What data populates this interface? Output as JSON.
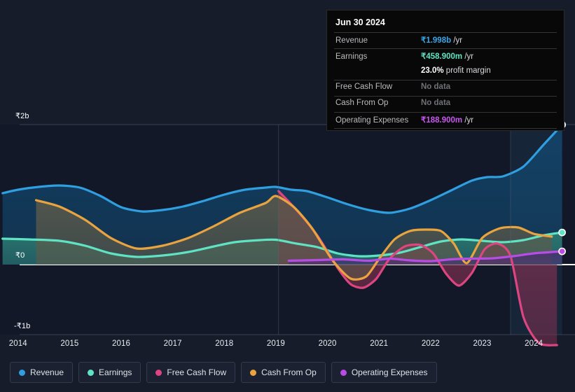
{
  "chart_data": {
    "type": "area",
    "title": "",
    "xlabel": "",
    "ylabel": "",
    "currency_symbol": "₹",
    "x_ticks": [
      "2014",
      "2015",
      "2016",
      "2017",
      "2018",
      "2019",
      "2020",
      "2021",
      "2022",
      "2023",
      "2024"
    ],
    "y_ticks": [
      {
        "label": "₹2b",
        "value": 2.0
      },
      {
        "label": "₹0",
        "value": 0.0
      },
      {
        "label": "-₹1b",
        "value": -1.0
      }
    ],
    "ylim": [
      -1.35,
      2.15
    ],
    "xlim": [
      2013.65,
      2024.8
    ],
    "grid": true,
    "legend_position": "bottom",
    "units": "billions of INR",
    "series": [
      {
        "name": "Revenue",
        "color": "#2f9fe0",
        "fill": "#12476e",
        "end_marker": true,
        "x": [
          2013.7,
          2014.0,
          2014.4,
          2014.8,
          2015.2,
          2015.6,
          2016.0,
          2016.4,
          2016.8,
          2017.2,
          2017.6,
          2018.0,
          2018.4,
          2018.8,
          2019.0,
          2019.3,
          2019.6,
          2020.0,
          2020.4,
          2020.8,
          2021.2,
          2021.6,
          2022.0,
          2022.4,
          2022.8,
          2023.1,
          2023.4,
          2023.8,
          2024.2,
          2024.55
        ],
        "y": [
          1.02,
          1.07,
          1.11,
          1.13,
          1.1,
          0.98,
          0.82,
          0.76,
          0.78,
          0.83,
          0.91,
          1.0,
          1.07,
          1.1,
          1.11,
          1.07,
          1.05,
          0.96,
          0.86,
          0.78,
          0.74,
          0.8,
          0.92,
          1.06,
          1.2,
          1.25,
          1.26,
          1.4,
          1.72,
          1.998
        ]
      },
      {
        "name": "Earnings",
        "color": "#5fe3c3",
        "fill": "#2f7f73",
        "end_marker": true,
        "x": [
          2013.7,
          2014.2,
          2014.8,
          2015.3,
          2015.8,
          2016.3,
          2016.8,
          2017.3,
          2017.8,
          2018.2,
          2018.7,
          2019.0,
          2019.4,
          2019.8,
          2020.2,
          2020.6,
          2021.0,
          2021.4,
          2021.8,
          2022.2,
          2022.6,
          2023.0,
          2023.4,
          2023.8,
          2024.2,
          2024.55
        ],
        "y": [
          0.37,
          0.36,
          0.34,
          0.27,
          0.16,
          0.11,
          0.13,
          0.18,
          0.26,
          0.32,
          0.35,
          0.355,
          0.3,
          0.25,
          0.16,
          0.12,
          0.13,
          0.17,
          0.25,
          0.33,
          0.36,
          0.34,
          0.32,
          0.35,
          0.42,
          0.4589
        ]
      },
      {
        "name": "Free Cash Flow",
        "color": "#dd4581",
        "fill": "#7b3050",
        "end_marker": false,
        "x": [
          2019.05,
          2019.4,
          2019.8,
          2020.2,
          2020.45,
          2020.7,
          2020.95,
          2021.2,
          2021.5,
          2021.8,
          2022.05,
          2022.3,
          2022.55,
          2022.8,
          2023.05,
          2023.3,
          2023.55,
          2023.8,
          2024.1,
          2024.45
        ],
        "y": [
          1.05,
          0.78,
          0.42,
          -0.05,
          -0.28,
          -0.33,
          -0.2,
          0.08,
          0.26,
          0.28,
          0.16,
          -0.13,
          -0.3,
          -0.12,
          0.22,
          0.3,
          0.12,
          -0.75,
          -1.12,
          -1.15
        ]
      },
      {
        "name": "Cash From Op",
        "color": "#e9a43f",
        "fill": "#5d5a4a",
        "end_marker": false,
        "x": [
          2014.35,
          2014.8,
          2015.3,
          2015.8,
          2016.3,
          2016.8,
          2017.3,
          2017.8,
          2018.3,
          2018.8,
          2019.0,
          2019.35,
          2019.7,
          2020.1,
          2020.45,
          2020.75,
          2021.0,
          2021.3,
          2021.6,
          2021.9,
          2022.2,
          2022.45,
          2022.7,
          2023.0,
          2023.35,
          2023.7,
          2024.0,
          2024.35
        ],
        "y": [
          0.92,
          0.83,
          0.64,
          0.38,
          0.23,
          0.27,
          0.38,
          0.55,
          0.74,
          0.88,
          0.98,
          0.82,
          0.52,
          0.06,
          -0.2,
          -0.17,
          0.08,
          0.36,
          0.48,
          0.5,
          0.48,
          0.3,
          0.02,
          0.38,
          0.52,
          0.53,
          0.44,
          0.4
        ],
        "second_segment": true
      },
      {
        "name": "Operating Expenses",
        "color": "#b84ce4",
        "fill": "#4a2c72",
        "end_marker": true,
        "x": [
          2019.25,
          2019.8,
          2020.3,
          2020.8,
          2021.2,
          2021.6,
          2022.0,
          2022.4,
          2022.8,
          2023.2,
          2023.6,
          2024.0,
          2024.55
        ],
        "y": [
          0.055,
          0.065,
          0.075,
          0.055,
          0.085,
          0.06,
          0.05,
          0.075,
          0.085,
          0.09,
          0.12,
          0.16,
          0.1889
        ]
      }
    ],
    "highlight_band": {
      "start": 2023.55,
      "end": 2024.55,
      "color": "#1e3550"
    }
  },
  "tooltip": {
    "date": "Jun 30 2024",
    "rows": [
      {
        "key": "Revenue",
        "amount": "₹1.998b",
        "suffix": " /yr",
        "color": "#3ba6e8",
        "no_data": false
      },
      {
        "key": "Earnings",
        "amount": "₹458.900m",
        "suffix": " /yr",
        "color": "#5fe3c3",
        "no_data": false
      },
      {
        "key": "",
        "amount": "23.0%",
        "suffix": " profit margin",
        "color": "#ffffff",
        "no_data": false,
        "no_border": true
      },
      {
        "key": "Free Cash Flow",
        "amount": "No data",
        "suffix": "",
        "color": "#6e7075",
        "no_data": true
      },
      {
        "key": "Cash From Op",
        "amount": "No data",
        "suffix": "",
        "color": "#6e7075",
        "no_data": true
      },
      {
        "key": "Operating Expenses",
        "amount": "₹188.900m",
        "suffix": " /yr",
        "color": "#c858ee",
        "no_data": false
      }
    ]
  },
  "legend": {
    "items": [
      {
        "label": "Revenue",
        "color": "#2f9fe0"
      },
      {
        "label": "Earnings",
        "color": "#5fe3c3"
      },
      {
        "label": "Free Cash Flow",
        "color": "#dd4581"
      },
      {
        "label": "Cash From Op",
        "color": "#e9a43f"
      },
      {
        "label": "Operating Expenses",
        "color": "#b84ce4"
      }
    ]
  },
  "colors": {
    "background": "#161c2a",
    "plot_background": "#121827",
    "zero_line": "#ffffff",
    "grid_line": "#4c5566",
    "tooltip_background": "#080808"
  }
}
